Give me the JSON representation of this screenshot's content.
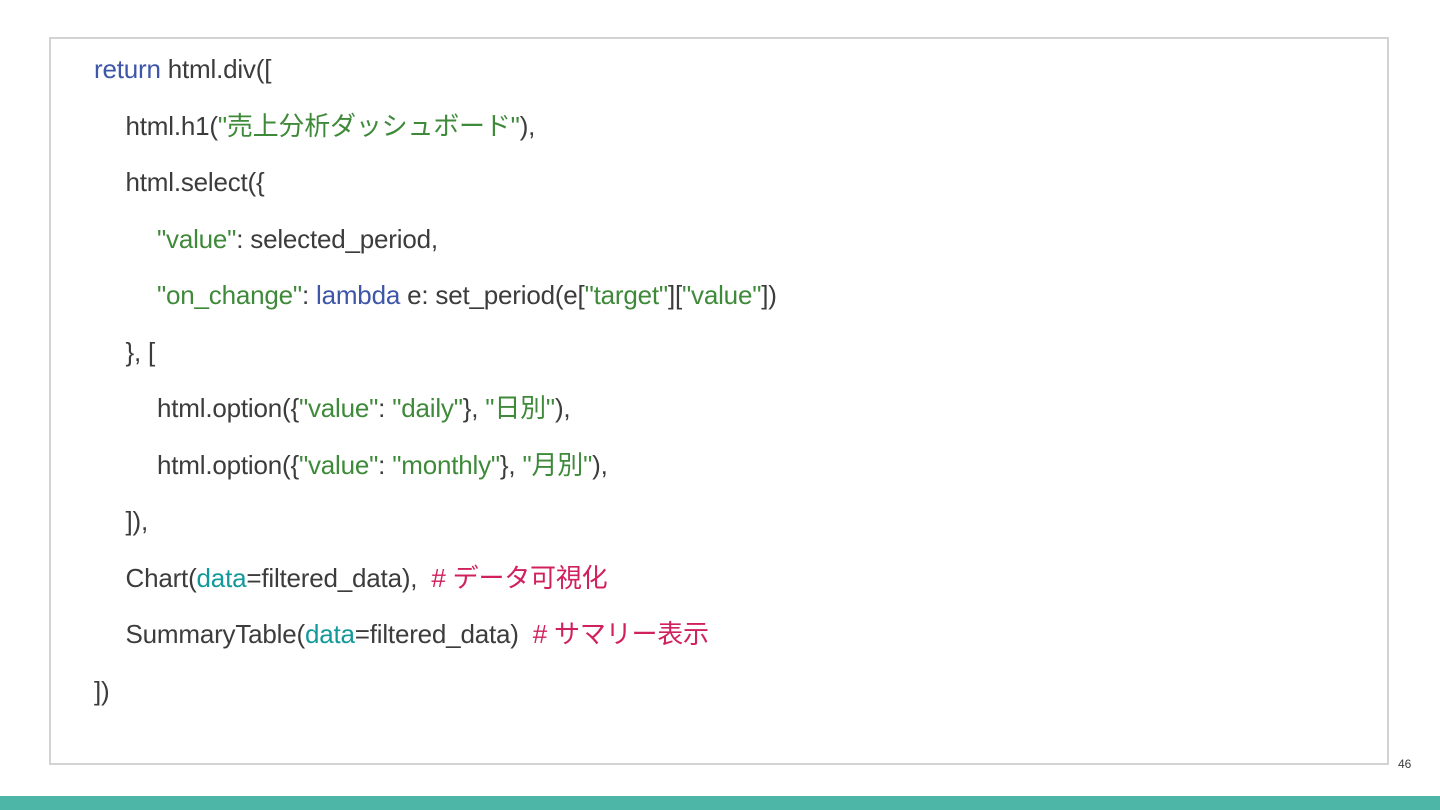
{
  "code_lines": [
    {
      "indent": 0,
      "tokens": [
        {
          "t": "return",
          "c": "kw"
        },
        {
          "t": " html.div([",
          "c": "plain"
        }
      ]
    },
    {
      "indent": 1,
      "tokens": [
        {
          "t": "html.h1(",
          "c": "plain"
        },
        {
          "t": "\"売上分析ダッシュボード\"",
          "c": "str"
        },
        {
          "t": "),",
          "c": "plain"
        }
      ]
    },
    {
      "indent": 1,
      "tokens": [
        {
          "t": "html.select({",
          "c": "plain"
        }
      ]
    },
    {
      "indent": 2,
      "tokens": [
        {
          "t": "\"value\"",
          "c": "str"
        },
        {
          "t": ": selected_period,",
          "c": "plain"
        }
      ]
    },
    {
      "indent": 2,
      "tokens": [
        {
          "t": "\"on_change\"",
          "c": "str"
        },
        {
          "t": ": ",
          "c": "plain"
        },
        {
          "t": "lambda",
          "c": "kw"
        },
        {
          "t": " e: set_period(e[",
          "c": "plain"
        },
        {
          "t": "\"target\"",
          "c": "str"
        },
        {
          "t": "][",
          "c": "plain"
        },
        {
          "t": "\"value\"",
          "c": "str"
        },
        {
          "t": "])",
          "c": "plain"
        }
      ]
    },
    {
      "indent": 1,
      "tokens": [
        {
          "t": "}, [",
          "c": "plain"
        }
      ]
    },
    {
      "indent": 2,
      "tokens": [
        {
          "t": "html.option({",
          "c": "plain"
        },
        {
          "t": "\"value\"",
          "c": "str"
        },
        {
          "t": ": ",
          "c": "plain"
        },
        {
          "t": "\"daily\"",
          "c": "str"
        },
        {
          "t": "}, ",
          "c": "plain"
        },
        {
          "t": "\"日別\"",
          "c": "str"
        },
        {
          "t": "),",
          "c": "plain"
        }
      ]
    },
    {
      "indent": 2,
      "tokens": [
        {
          "t": "html.option({",
          "c": "plain"
        },
        {
          "t": "\"value\"",
          "c": "str"
        },
        {
          "t": ": ",
          "c": "plain"
        },
        {
          "t": "\"monthly\"",
          "c": "str"
        },
        {
          "t": "}, ",
          "c": "plain"
        },
        {
          "t": "\"月別\"",
          "c": "str"
        },
        {
          "t": "),",
          "c": "plain"
        }
      ]
    },
    {
      "indent": 1,
      "tokens": [
        {
          "t": "]),",
          "c": "plain"
        }
      ]
    },
    {
      "indent": 1,
      "tokens": [
        {
          "t": "Chart(",
          "c": "plain"
        },
        {
          "t": "data",
          "c": "param"
        },
        {
          "t": "=filtered_data),  ",
          "c": "plain"
        },
        {
          "t": "# データ可視化",
          "c": "comment"
        }
      ]
    },
    {
      "indent": 1,
      "tokens": [
        {
          "t": "SummaryTable(",
          "c": "plain"
        },
        {
          "t": "data",
          "c": "param"
        },
        {
          "t": "=filtered_data)  ",
          "c": "plain"
        },
        {
          "t": "# サマリー表示",
          "c": "comment"
        }
      ]
    },
    {
      "indent": 0,
      "tokens": [
        {
          "t": "])",
          "c": "plain"
        }
      ]
    }
  ],
  "page_number": "46",
  "colors": {
    "keyword": "#3d56a8",
    "string": "#3f8a3a",
    "parameter": "#13999b",
    "comment": "#d1205e",
    "text": "#3c3c3c",
    "border": "#d3d3d3",
    "bottom_bar": "#4db6a7"
  }
}
